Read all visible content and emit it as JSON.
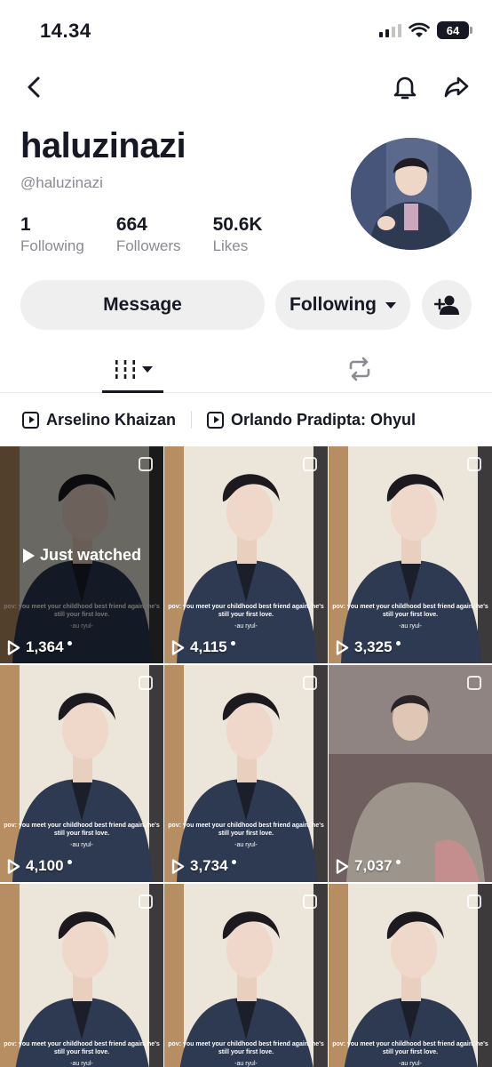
{
  "status_bar": {
    "time": "14.34",
    "battery": "64"
  },
  "profile": {
    "name": "haluzinazi",
    "handle": "@haluzinazi",
    "stats": [
      {
        "value": "1",
        "label": "Following"
      },
      {
        "value": "664",
        "label": "Followers"
      },
      {
        "value": "50.6K",
        "label": "Likes"
      }
    ]
  },
  "actions": {
    "message": "Message",
    "following": "Following"
  },
  "playlists": [
    {
      "label": "Arselino Khaizan"
    },
    {
      "label": "Orlando Pradipta: Ohyul"
    }
  ],
  "videos": [
    {
      "views": "1,364",
      "overlay": "Just watched",
      "caption": "pov: you meet your childhood best friend again, he's still your first love.",
      "author": "-au ryul-"
    },
    {
      "views": "4,115",
      "caption": "pov: you meet your childhood best friend again, he's still your first love.",
      "author": "-au ryul-"
    },
    {
      "views": "3,325",
      "caption": "pov: you meet your childhood best friend again, he's still your first love.",
      "author": "-au ryul-"
    },
    {
      "views": "4,100",
      "caption": "pov: you meet your childhood best friend again, he's still your first love.",
      "author": "-au ryul-"
    },
    {
      "views": "3,734",
      "caption": "pov: you meet your childhood best friend again, he's still your first love.",
      "author": "-au ryul-"
    },
    {
      "views": "7,037"
    },
    {
      "caption": "pov: you meet your childhood best friend again, he's still your first love.",
      "author": "-au ryul-"
    },
    {
      "caption": "pov: you meet your childhood best friend again, he's still your first love.",
      "author": "-au ryul-"
    },
    {
      "caption": "pov: you meet your childhood best friend again, he's still your first love.",
      "author": "-au ryul-"
    }
  ],
  "colors": {
    "text": "#161823",
    "muted": "#8a8b91",
    "pill": "#efefef",
    "jacket": "#2e3a52"
  }
}
